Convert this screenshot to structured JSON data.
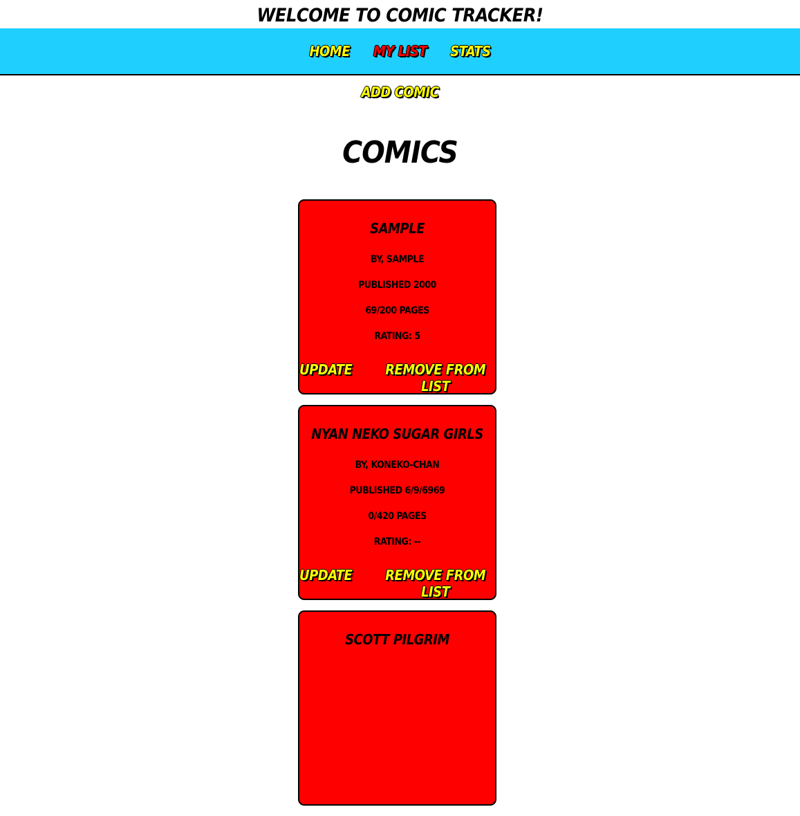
{
  "header": {
    "title": "Welcome to Comic Tracker!"
  },
  "nav": {
    "items": [
      {
        "label": "Home",
        "active": false
      },
      {
        "label": "My List",
        "active": true
      },
      {
        "label": "Stats",
        "active": false
      }
    ]
  },
  "actions": {
    "add_label": "Add Comic"
  },
  "main": {
    "heading": "Comics"
  },
  "comics": [
    {
      "title": "Sample",
      "author": "By, Sample",
      "published": "Published 2000",
      "pages": "69/200 Pages",
      "rating": "Rating: 5",
      "update_label": "Update",
      "remove_label": "Remove From List"
    },
    {
      "title": "Nyan Neko Sugar Girls",
      "author": "By, Koneko-Chan",
      "published": "Published 6/9/6969",
      "pages": "0/420 Pages",
      "rating": "Rating: --",
      "update_label": "Update",
      "remove_label": "Remove From List"
    },
    {
      "title": "Scott Pilgrim"
    }
  ],
  "colors": {
    "nav_background": "#1fd0ff",
    "card_background": "#ff0000",
    "link_color": "#ffff00",
    "active_link_color": "#ff0000"
  }
}
